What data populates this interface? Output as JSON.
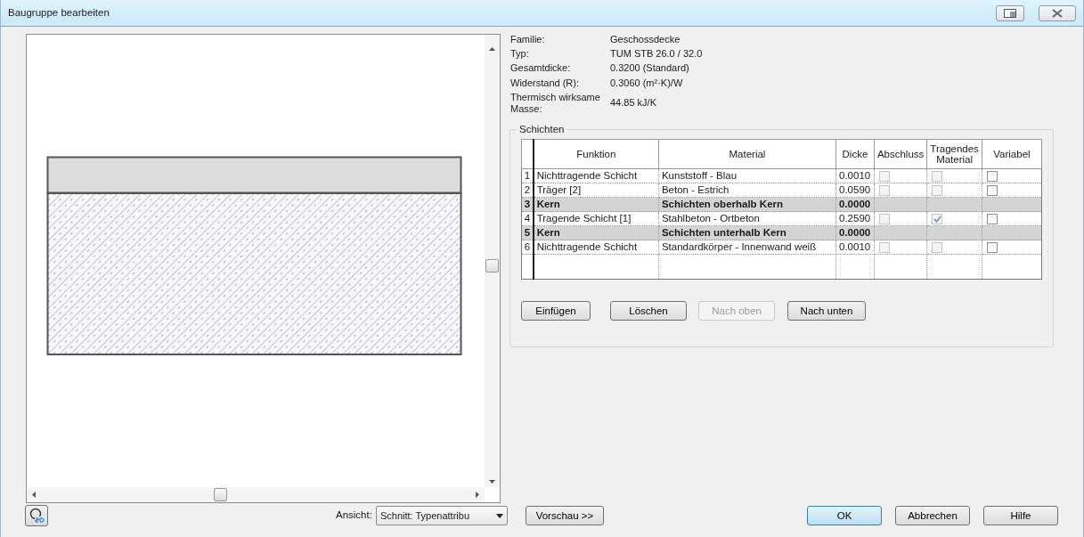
{
  "window": {
    "title": "Baugruppe bearbeiten"
  },
  "properties": [
    {
      "label": "Familie:",
      "value": "Geschossdecke"
    },
    {
      "label": "Typ:",
      "value": "TUM STB 26.0 / 32.0"
    },
    {
      "label": "Gesamtdicke:",
      "value": "0.3200 (Standard)"
    },
    {
      "label": "Widerstand (R):",
      "value": "0.3060 (m²·K)/W"
    },
    {
      "label": "Thermisch wirksame Masse:",
      "value": "44.85 kJ/K"
    }
  ],
  "layers": {
    "title": "Schichten",
    "columns": [
      {
        "label": "Funktion",
        "kind": "text"
      },
      {
        "label": "Material",
        "kind": "text"
      },
      {
        "label": "Dicke",
        "kind": "text"
      },
      {
        "label": "Abschluss",
        "kind": "check",
        "disabled": true
      },
      {
        "label": "Tragendes Material",
        "kind": "check",
        "disabled": true
      },
      {
        "label": "Variabel",
        "kind": "check",
        "disabled": false
      }
    ],
    "rows": [
      {
        "kind": "layer",
        "number": "1",
        "cells": [
          "Nichttragende Schicht",
          "Kunststoff - Blau",
          "0.0010"
        ],
        "checks": [
          false,
          false,
          false
        ]
      },
      {
        "kind": "layer",
        "number": "2",
        "cells": [
          "Träger [2]",
          "Beton - Estrich",
          "0.0590"
        ],
        "checks": [
          false,
          false,
          false
        ]
      },
      {
        "kind": "core",
        "number": "3",
        "cells": [
          "Kern",
          "Schichten oberhalb Kern",
          "0.0000"
        ]
      },
      {
        "kind": "layer",
        "number": "4",
        "cells": [
          "Tragende Schicht [1]",
          "Stahlbeton - Ortbeton",
          "0.2590"
        ],
        "checks": [
          false,
          true,
          false
        ]
      },
      {
        "kind": "core",
        "number": "5",
        "cells": [
          "Kern",
          "Schichten unterhalb Kern",
          "0.0000"
        ]
      },
      {
        "kind": "layer",
        "number": "6",
        "cells": [
          "Nichttragende Schicht",
          "Standardkörper - Innenwand weiß",
          "0.0010"
        ],
        "checks": [
          false,
          false,
          false
        ]
      }
    ],
    "buttons": [
      {
        "label": "Einfügen",
        "disabled": false
      },
      {
        "label": "Löschen",
        "disabled": false
      },
      {
        "label": "Nach oben",
        "disabled": true
      },
      {
        "label": "Nach unten",
        "disabled": false
      }
    ]
  },
  "footer": {
    "view_label": "Ansicht:",
    "view_value": "Schnitt: Typenattribu",
    "preview_button": "Vorschau >>",
    "buttons": [
      {
        "label": "OK",
        "default": true
      },
      {
        "label": "Abbrechen",
        "default": false
      },
      {
        "label": "Hilfe",
        "default": false
      }
    ]
  }
}
